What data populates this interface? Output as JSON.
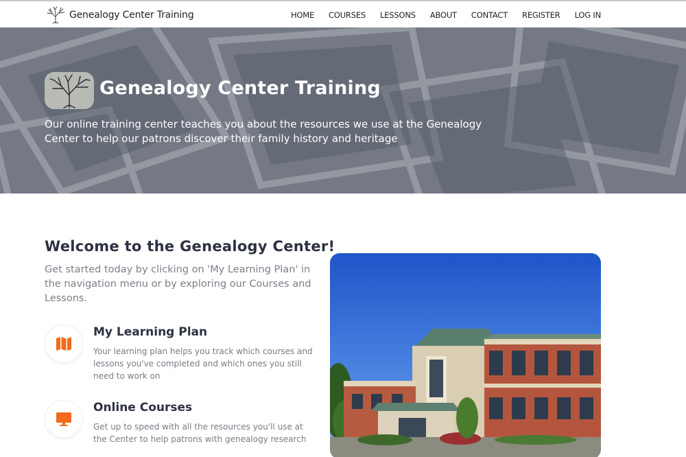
{
  "brand": {
    "name": "Genealogy Center Training"
  },
  "nav": {
    "items": [
      "HOME",
      "COURSES",
      "LESSONS",
      "ABOUT",
      "CONTACT",
      "REGISTER",
      "LOG IN"
    ]
  },
  "hero": {
    "title": "Genealogy Center Training",
    "subtitle": "Our online training center teaches you about the resources we use at the Genealogy Center to help our patrons discover their family history and heritage"
  },
  "main": {
    "heading": "Welcome to the Genealogy Center!",
    "intro": "Get started today by clicking on 'My Learning Plan' in the navigation menu or by exploring our Courses and Lessons.",
    "features": [
      {
        "title": "My Learning Plan",
        "description": "Your learning plan helps you track which courses and lessons you've completed and which ones you still need to work on",
        "icon": "map-icon"
      },
      {
        "title": "Online Courses",
        "description": "Get up to speed with all the resources you'll use at the Center to help patrons with genealogy research",
        "icon": "monitor-icon"
      }
    ]
  },
  "colors": {
    "accent": "#f26b1d",
    "heading": "#2d3142",
    "muted": "#7a8089"
  }
}
